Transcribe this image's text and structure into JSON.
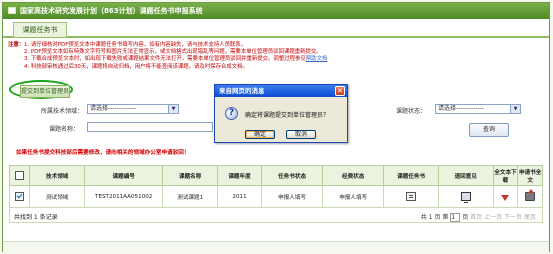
{
  "app": {
    "title": "国家高技术研究发展计划（863计划）课题任务书申报系统"
  },
  "tab": {
    "label": "课题任务书"
  },
  "notes": {
    "label": "注意：",
    "items": [
      "1. 请仔细核对PDF预览文本中课题任务书填写内容，如有内容缺失，请与技术支持人员联系。",
      "2. PDF预览文本如有特殊文字符号和图片无法正常显示，或文档格式出现错乱等问题，需要本单位管理员驳回课题重新提交。",
      "3. 下载合成预览文本时，如出现下载失败或课题结果文件无法打开，需要本单位管理员驳回并重新提交。调整过程参见",
      "4. 科技部审核通过后30天，课题将自动归档，用户将不能查阅该课题，请及时保存合成文档。"
    ],
    "help_link": "帮助文档"
  },
  "submit_button": "提交到单位管理员",
  "search": {
    "field_label": "所属技术领域：",
    "field_value": "请选择-------------",
    "status_label": "课题状态：",
    "status_value": "请选择-------------",
    "name_label": "课题名称：",
    "name_value": "",
    "query_button": "查询"
  },
  "warning": "如果任务书提交科技部后需要修改，请向相关的领域办公室申请驳回！",
  "table": {
    "headers": [
      "技术领域",
      "课题编号",
      "课题名称",
      "课题年度",
      "任务书状态",
      "经费状态",
      "课题任务书",
      "退回意见",
      "全文本下载",
      "申请书全文"
    ],
    "rows": [
      {
        "checked": true,
        "field": "测试领域",
        "code": "TEST2011AA051002",
        "name": "测试课题1",
        "year": "2011",
        "status": "申报人填写",
        "funding": "申报人填写"
      }
    ]
  },
  "footer": {
    "total": "共找到 1 条记录",
    "page_prefix": "共",
    "page_total": "1",
    "page_mid": "页 第",
    "page_current": "1",
    "page_suffix": "页",
    "first": "首页",
    "prev": "上一页",
    "next": "下一页",
    "last": "尾页"
  },
  "dialog": {
    "title": "来自网页的消息",
    "message": "确定将课题提交到单位管理员？",
    "ok": "确定",
    "cancel": "取消"
  },
  "colors": {
    "accent": "#5c9a2f",
    "warning": "#d00000",
    "dialog_title": "#0a4bd0"
  },
  "icons": [
    "question-icon",
    "document-icon",
    "monitor-icon",
    "download-icon",
    "upload-icon",
    "close-icon"
  ]
}
